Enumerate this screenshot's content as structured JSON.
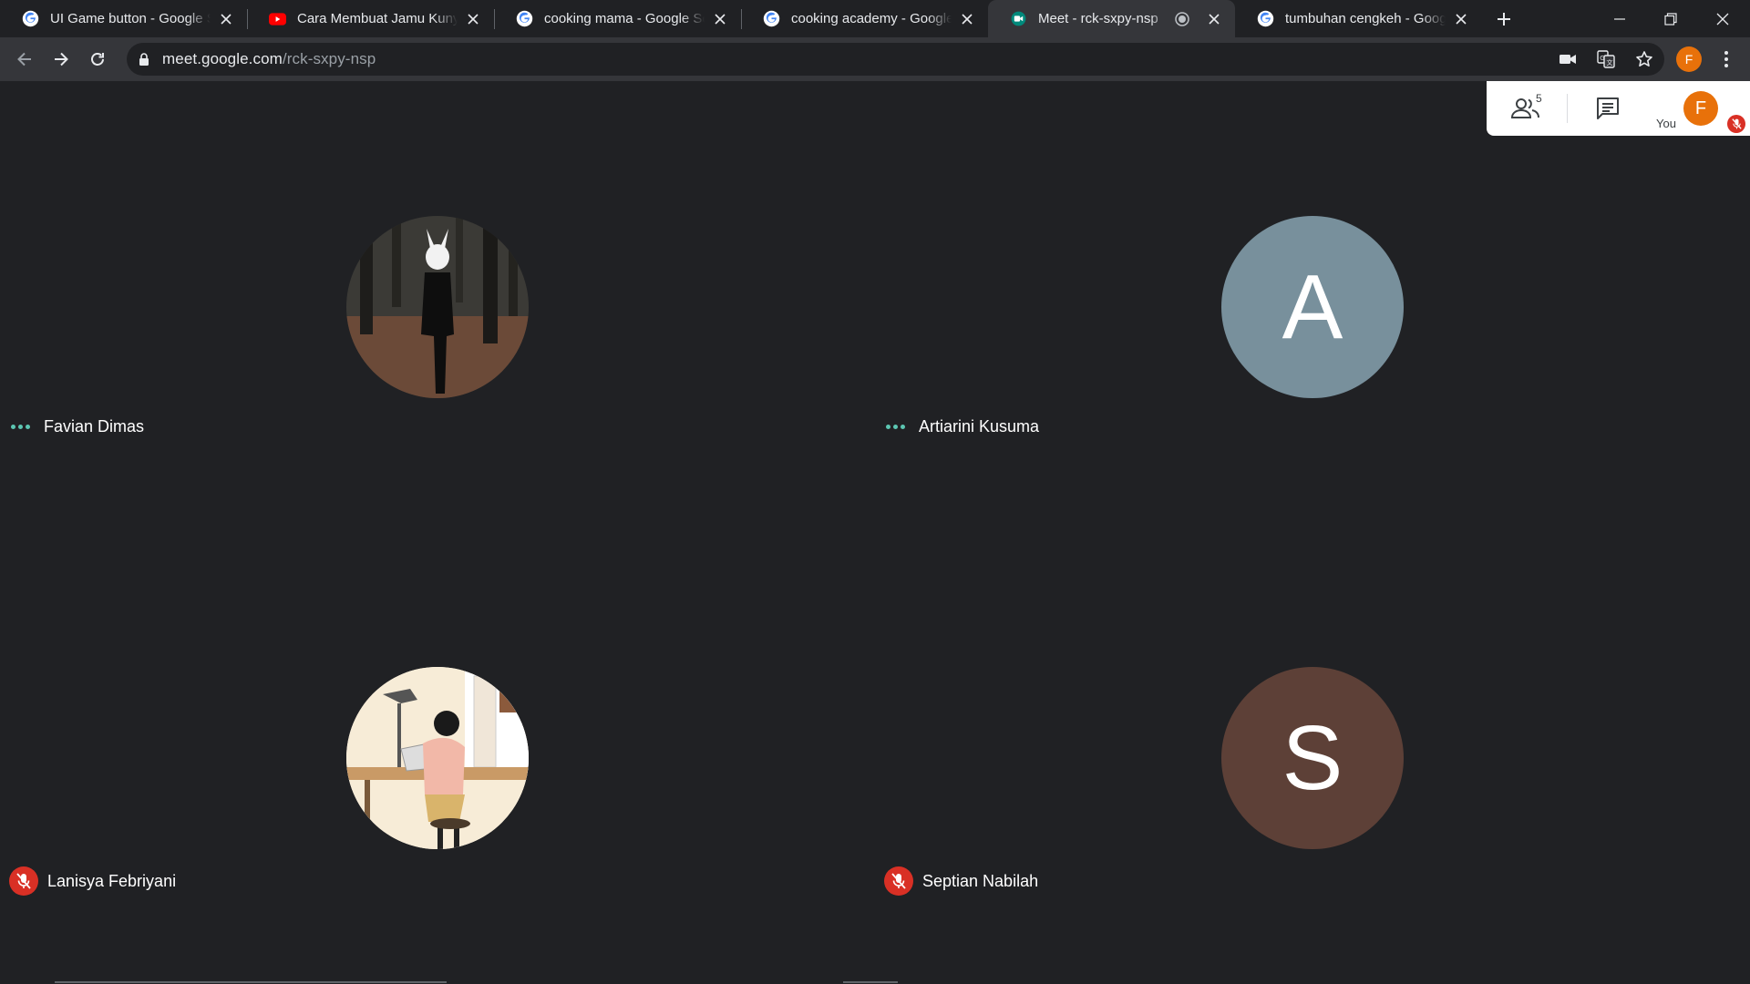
{
  "browser": {
    "tabs": [
      {
        "title": "UI Game button - Google Search",
        "favicon": "google-icon"
      },
      {
        "title": "Cara Membuat Jamu Kunyit Asam",
        "favicon": "youtube-icon"
      },
      {
        "title": "cooking mama - Google Search",
        "favicon": "google-icon"
      },
      {
        "title": "cooking academy - Google Search",
        "favicon": "google-icon"
      },
      {
        "title": "Meet - rck-sxpy-nsp",
        "favicon": "meet-icon",
        "active": true
      },
      {
        "title": "tumbuhan cengkeh - Google Search",
        "favicon": "google-icon"
      }
    ],
    "url_host": "meet.google.com",
    "url_path": "/rck-sxpy-nsp",
    "profile_initial": "F",
    "profile_color": "#e8710a"
  },
  "meet": {
    "people_count": "5",
    "you_label": "You",
    "self_initial": "F",
    "participants": [
      {
        "name": "Favian Dimas",
        "status": "speaking-indicator",
        "avatar_type": "photo-forest"
      },
      {
        "name": "Artiarini Kusuma",
        "status": "speaking-indicator",
        "avatar_type": "letter",
        "initial": "A",
        "color": "#78909c"
      },
      {
        "name": "Lanisya Febriyani",
        "status": "muted",
        "avatar_type": "photo-illustration"
      },
      {
        "name": "Septian Nabilah",
        "status": "muted",
        "avatar_type": "letter",
        "initial": "S",
        "color": "#5d4037"
      }
    ]
  }
}
